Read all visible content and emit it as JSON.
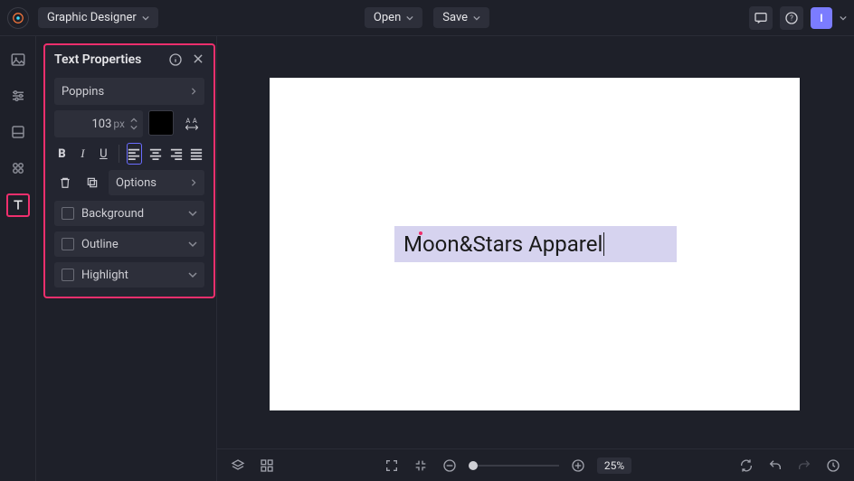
{
  "topbar": {
    "role": "Graphic Designer",
    "open_label": "Open",
    "save_label": "Save",
    "avatar_letter": "I"
  },
  "panel": {
    "title": "Text Properties",
    "font_family": "Poppins",
    "font_size_value": "103",
    "font_size_unit": "px",
    "color_swatch": "#000000",
    "options_label": "Options",
    "collapsibles": [
      {
        "label": "Background"
      },
      {
        "label": "Outline"
      },
      {
        "label": "Highlight"
      }
    ]
  },
  "canvas": {
    "text_value": "Moon&Stars Apparel"
  },
  "bottom": {
    "zoom_pct": "25%"
  },
  "icons": {
    "chevron_down": "chevron-down-icon",
    "chevron_right": "chevron-right-icon",
    "info": "info-icon",
    "close": "close-icon"
  }
}
